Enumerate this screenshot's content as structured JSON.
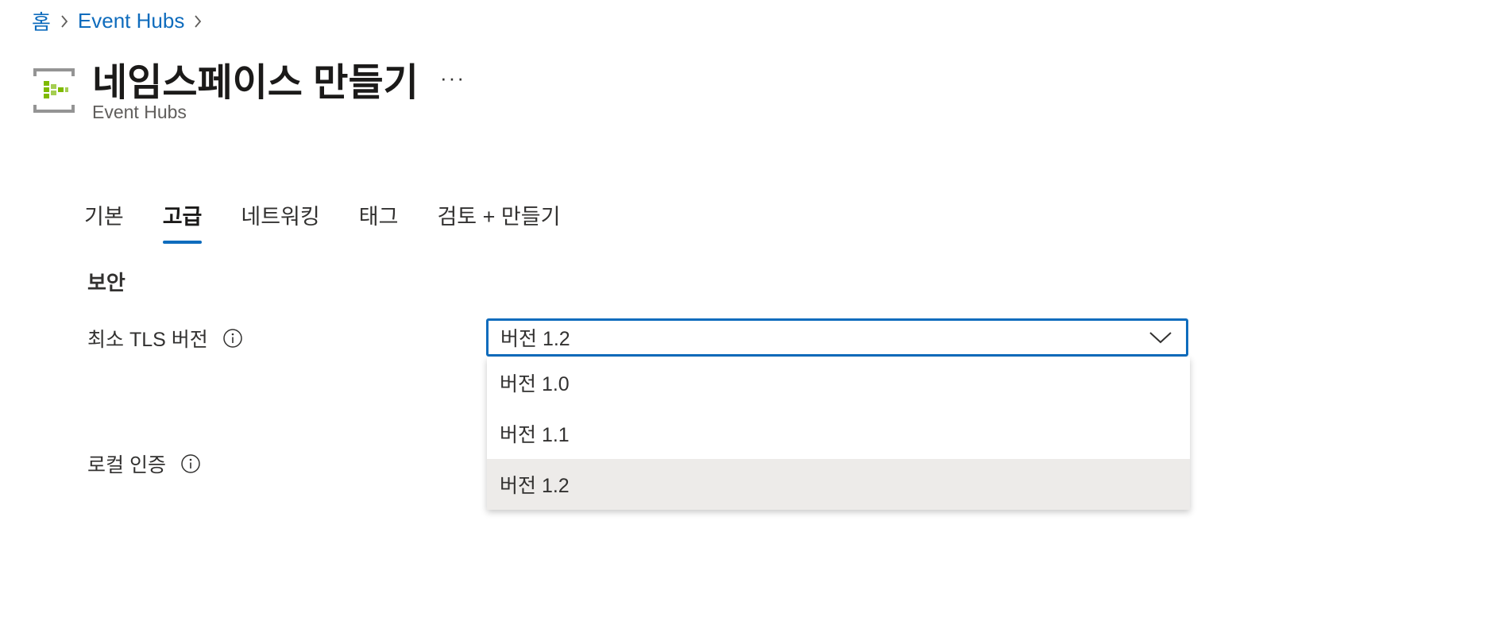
{
  "breadcrumb": {
    "items": [
      "홈",
      "Event Hubs"
    ]
  },
  "header": {
    "title": "네임스페이스 만들기",
    "subtitle": "Event Hubs",
    "more_label": "···"
  },
  "tabs": [
    {
      "label": "기본",
      "active": false
    },
    {
      "label": "고급",
      "active": true
    },
    {
      "label": "네트워킹",
      "active": false
    },
    {
      "label": "태그",
      "active": false
    },
    {
      "label": "검토 + 만들기",
      "active": false
    }
  ],
  "section": {
    "title": "보안"
  },
  "fields": {
    "min_tls": {
      "label": "최소 TLS 버전",
      "value": "버전 1.2",
      "options": [
        "버전 1.0",
        "버전 1.1",
        "버전 1.2"
      ],
      "selected_index": 2
    },
    "local_auth": {
      "label": "로컬 인증"
    }
  },
  "colors": {
    "accent": "#0f6cbd",
    "icon_green": "#7fba00",
    "icon_gray": "#949494",
    "selected_option_bg": "#edebe9"
  },
  "icons": {
    "breadcrumb_separator": "chevron-right-icon",
    "resource": "event-hubs-icon",
    "info": "info-icon",
    "dropdown": "chevron-down-icon"
  }
}
